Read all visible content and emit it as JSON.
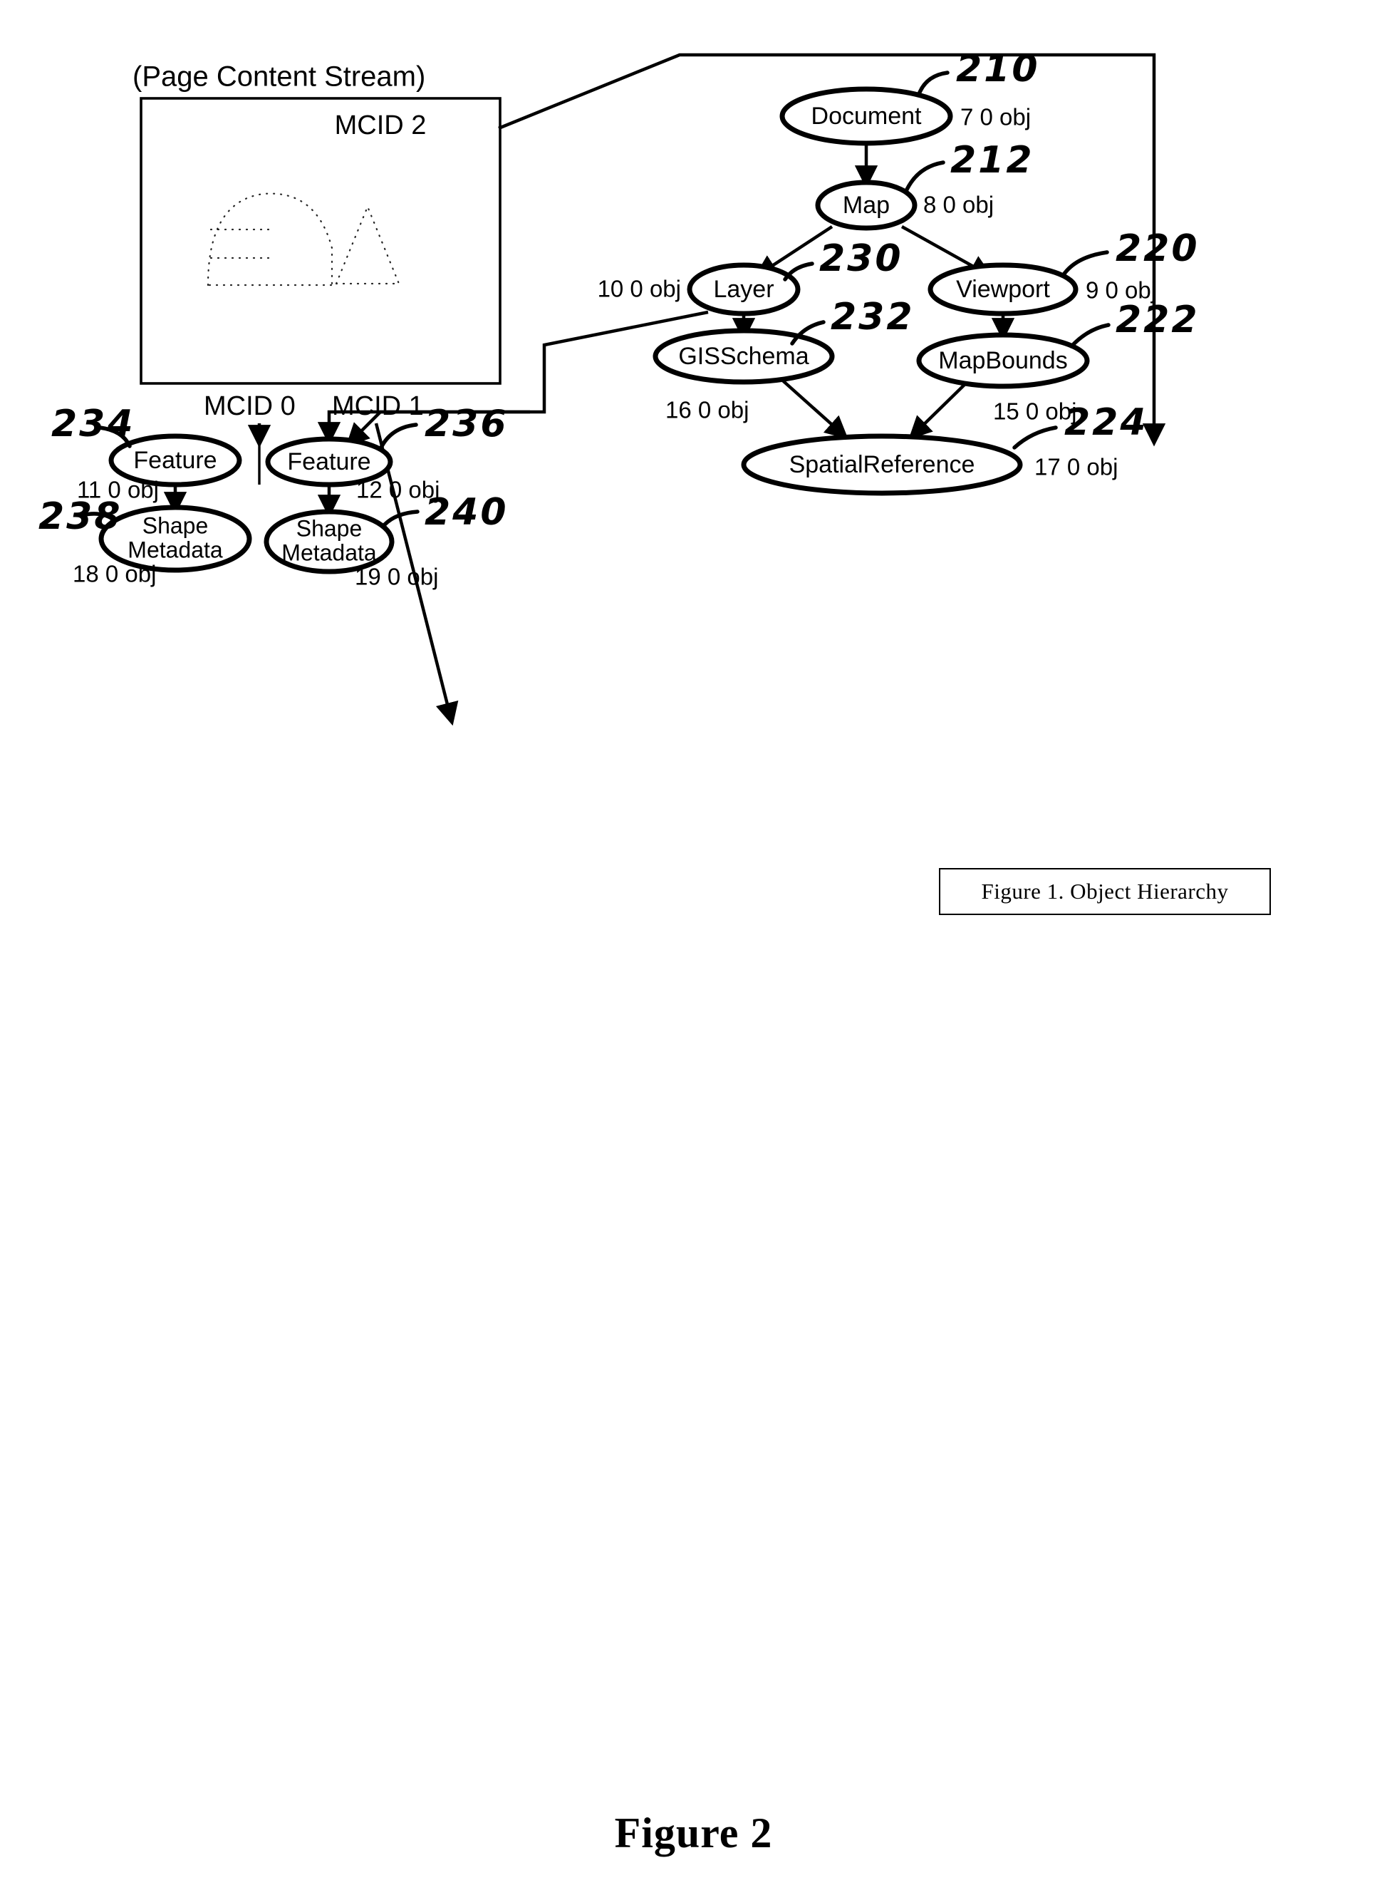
{
  "figure": {
    "bottom_caption": "Figure 2",
    "inset_caption": "Figure 1.  Object Hierarchy"
  },
  "content_stream": {
    "title": "(Page Content Stream)",
    "mcid_2": "MCID 2",
    "mcid_0": "MCID 0",
    "mcid_1": "MCID 1"
  },
  "nodes": {
    "document": {
      "label": "Document",
      "obj": "7 0 obj",
      "ref": "210"
    },
    "map": {
      "label": "Map",
      "obj": "8 0 obj",
      "ref": "212"
    },
    "layer": {
      "label": "Layer",
      "obj": "10 0 obj",
      "ref": "230"
    },
    "viewport": {
      "label": "Viewport",
      "obj": "9 0 obj",
      "ref": "220"
    },
    "gisschema": {
      "label": "GISSchema",
      "obj": "16 0 obj",
      "ref": "232"
    },
    "mapbounds": {
      "label": "MapBounds",
      "obj": "15 0 obj",
      "ref": "222"
    },
    "feature_1": {
      "label": "Feature",
      "obj": "11 0 obj",
      "ref": "234"
    },
    "feature_2": {
      "label": "Feature",
      "obj": "12 0 obj",
      "ref": "236"
    },
    "spatialreference": {
      "label": "SpatialReference",
      "obj": "17 0 obj",
      "ref": "224"
    },
    "shape_metadata_1": {
      "label_line1": "Shape",
      "label_line2": "Metadata",
      "obj": "18 0 obj",
      "ref": "238"
    },
    "shape_metadata_2": {
      "label_line1": "Shape",
      "label_line2": "Metadata",
      "obj": "19 0 obj",
      "ref": "240"
    }
  },
  "colors": {
    "ink": "#000000",
    "paper": "#ffffff"
  }
}
